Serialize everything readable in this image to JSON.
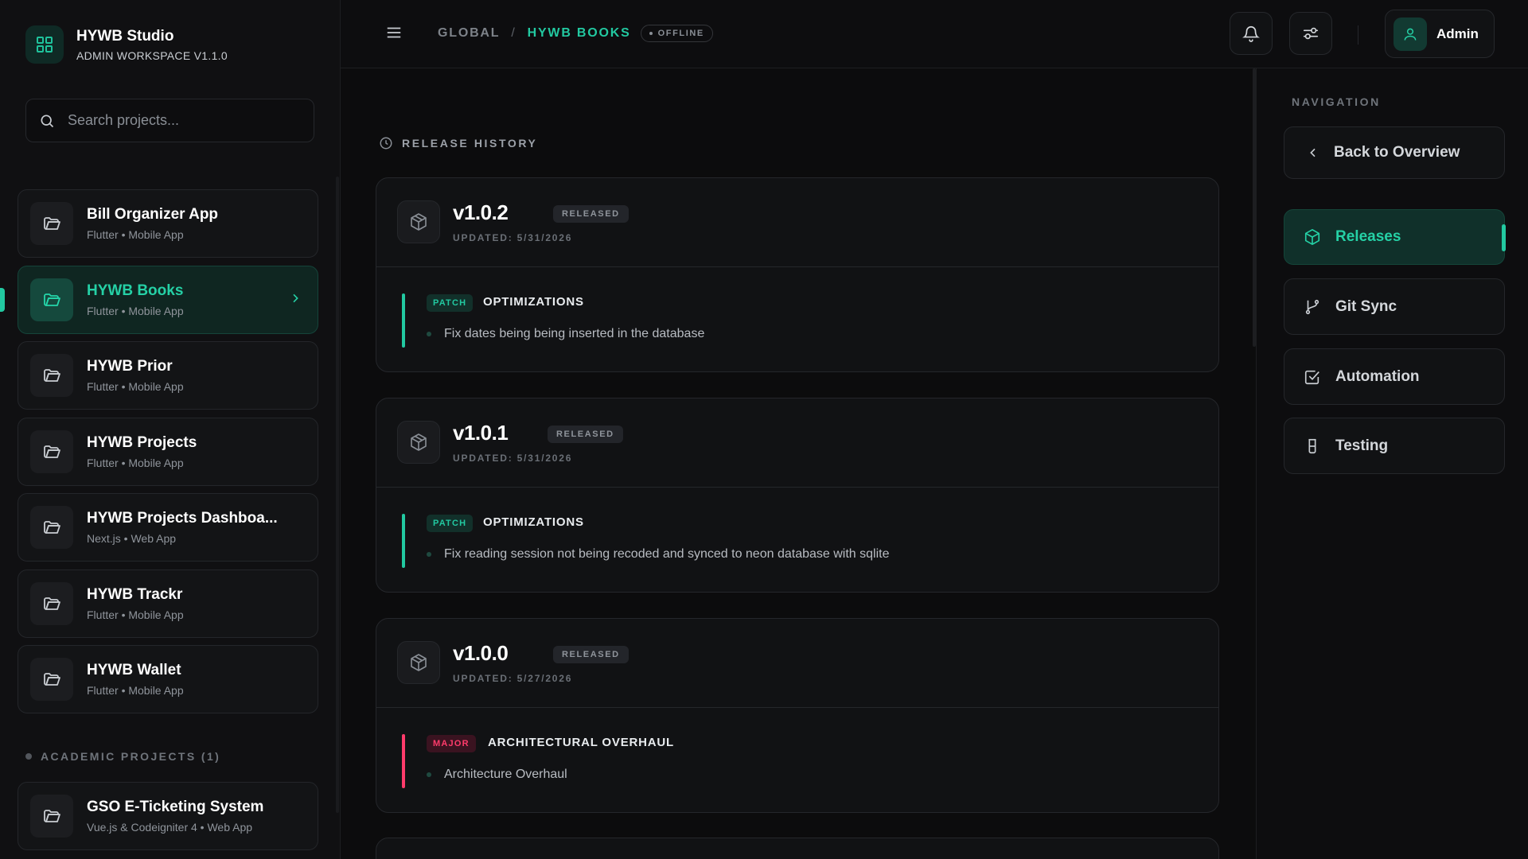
{
  "brand": {
    "title": "HYWB Studio",
    "subtitle": "ADMIN WORKSPACE V1.1.0"
  },
  "search": {
    "placeholder": "Search projects..."
  },
  "projects": [
    {
      "name": "Bill Organizer App",
      "meta": "Flutter • Mobile App",
      "active": false
    },
    {
      "name": "HYWB Books",
      "meta": "Flutter • Mobile App",
      "active": true
    },
    {
      "name": "HYWB Prior",
      "meta": "Flutter • Mobile App",
      "active": false
    },
    {
      "name": "HYWB Projects",
      "meta": "Flutter • Mobile App",
      "active": false
    },
    {
      "name": "HYWB Projects Dashboa...",
      "meta": "Next.js • Web App",
      "active": false
    },
    {
      "name": "HYWB Trackr",
      "meta": "Flutter • Mobile App",
      "active": false
    },
    {
      "name": "HYWB Wallet",
      "meta": "Flutter • Mobile App",
      "active": false
    }
  ],
  "academic": {
    "label": "ACADEMIC PROJECTS (1)",
    "projects": [
      {
        "name": "GSO E-Ticketing System",
        "meta": "Vue.js & Codeigniter 4 • Web App"
      }
    ]
  },
  "header": {
    "crumb_global": "GLOBAL",
    "crumb_sep": "/",
    "crumb_current": "HYWB BOOKS",
    "status_badge": "OFFLINE",
    "user_name": "Admin"
  },
  "release_history": {
    "label": "RELEASE HISTORY",
    "releases": [
      {
        "version": "v1.0.2",
        "status": "RELEASED",
        "updated": "UPDATED: 5/31/2026",
        "tag": "PATCH",
        "tag_type": "patch",
        "title": "OPTIMIZATIONS",
        "item": "Fix dates being being inserted in the database"
      },
      {
        "version": "v1.0.1",
        "status": "RELEASED",
        "updated": "UPDATED: 5/31/2026",
        "tag": "PATCH",
        "tag_type": "patch",
        "title": "OPTIMIZATIONS",
        "item": "Fix reading session not being recoded and synced to neon database with sqlite"
      },
      {
        "version": "v1.0.0",
        "status": "RELEASED",
        "updated": "UPDATED: 5/27/2026",
        "tag": "MAJOR",
        "tag_type": "major",
        "title": "ARCHITECTURAL OVERHAUL",
        "item": "Architecture Overhaul"
      }
    ]
  },
  "navigation": {
    "label": "NAVIGATION",
    "back": "Back to Overview",
    "items": [
      {
        "label": "Releases",
        "icon": "package-icon",
        "active": true
      },
      {
        "label": "Git Sync",
        "icon": "git-branch-icon",
        "active": false
      },
      {
        "label": "Automation",
        "icon": "checkbox-icon",
        "active": false
      },
      {
        "label": "Testing",
        "icon": "flask-icon",
        "active": false
      }
    ]
  },
  "colors": {
    "accent": "#22c9a1",
    "major": "#ff3b6b",
    "background": "#0c0c0d"
  }
}
